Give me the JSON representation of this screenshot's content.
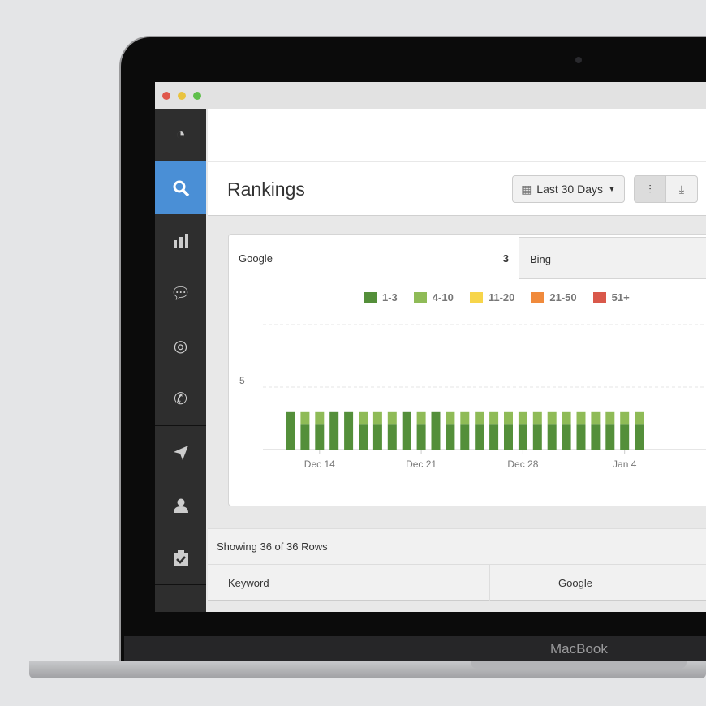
{
  "device_label": "MacBook",
  "sidebar": {
    "items": [
      {
        "icon": "dashboard-icon"
      },
      {
        "icon": "search-icon",
        "active": true
      },
      {
        "icon": "bar-chart-icon"
      },
      {
        "icon": "chat-icon"
      },
      {
        "icon": "target-icon"
      },
      {
        "icon": "phone-icon"
      },
      {
        "icon": "send-icon"
      },
      {
        "icon": "user-icon"
      },
      {
        "icon": "clipboard-check-icon"
      }
    ]
  },
  "header": {
    "title": "Rankings",
    "date_range": "Last 30 Days"
  },
  "tabs": [
    {
      "label": "Google",
      "count": "3"
    },
    {
      "label": "Bing"
    }
  ],
  "colors": {
    "accent": "#4a8fd6",
    "r1_3": "#548f3a",
    "r4_10": "#8fbb57",
    "r11_20": "#f7d54a",
    "r21_50": "#f08a3c",
    "r51": "#d9584a"
  },
  "chart_data": {
    "type": "bar",
    "stacked": true,
    "legend": "top",
    "grid": true,
    "legend_entries": [
      "1-3",
      "4-10",
      "11-20",
      "21-50",
      "51+"
    ],
    "x": [
      "Dec 12",
      "Dec 13",
      "Dec 14",
      "Dec 15",
      "Dec 16",
      "Dec 17",
      "Dec 18",
      "Dec 19",
      "Dec 20",
      "Dec 21",
      "Dec 22",
      "Dec 23",
      "Dec 24",
      "Dec 25",
      "Dec 26",
      "Dec 27",
      "Dec 28",
      "Dec 29",
      "Dec 30",
      "Dec 31",
      "Jan 1",
      "Jan 2",
      "Jan 3",
      "Jan 4",
      "Jan 5"
    ],
    "x_ticks": [
      "Dec 14",
      "Dec 21",
      "Dec 28",
      "Jan 4"
    ],
    "y_ticks": [
      "5"
    ],
    "ylim": [
      0,
      10
    ],
    "series": [
      {
        "name": "1-3",
        "values": [
          3,
          2,
          2,
          3,
          3,
          2,
          2,
          2,
          3,
          2,
          3,
          2,
          2,
          2,
          2,
          2,
          2,
          2,
          2,
          2,
          2,
          2,
          2,
          2,
          2
        ]
      },
      {
        "name": "4-10",
        "values": [
          0,
          1,
          1,
          0,
          0,
          1,
          1,
          1,
          0,
          1,
          0,
          1,
          1,
          1,
          1,
          1,
          1,
          1,
          1,
          1,
          1,
          1,
          1,
          1,
          1
        ]
      },
      {
        "name": "11-20",
        "values": [
          0,
          0,
          0,
          0,
          0,
          0,
          0,
          0,
          0,
          0,
          0,
          0,
          0,
          0,
          0,
          0,
          0,
          0,
          0,
          0,
          0,
          0,
          0,
          0,
          0
        ]
      },
      {
        "name": "21-50",
        "values": [
          0,
          0,
          0,
          0,
          0,
          0,
          0,
          0,
          0,
          0,
          0,
          0,
          0,
          0,
          0,
          0,
          0,
          0,
          0,
          0,
          0,
          0,
          0,
          0,
          0
        ]
      },
      {
        "name": "51+",
        "values": [
          0,
          0,
          0,
          0,
          0,
          0,
          0,
          0,
          0,
          0,
          0,
          0,
          0,
          0,
          0,
          0,
          0,
          0,
          0,
          0,
          0,
          0,
          0,
          0,
          0
        ]
      }
    ]
  },
  "table": {
    "status": "Showing 36 of 36 Rows",
    "columns": [
      "Keyword",
      "Google"
    ]
  }
}
